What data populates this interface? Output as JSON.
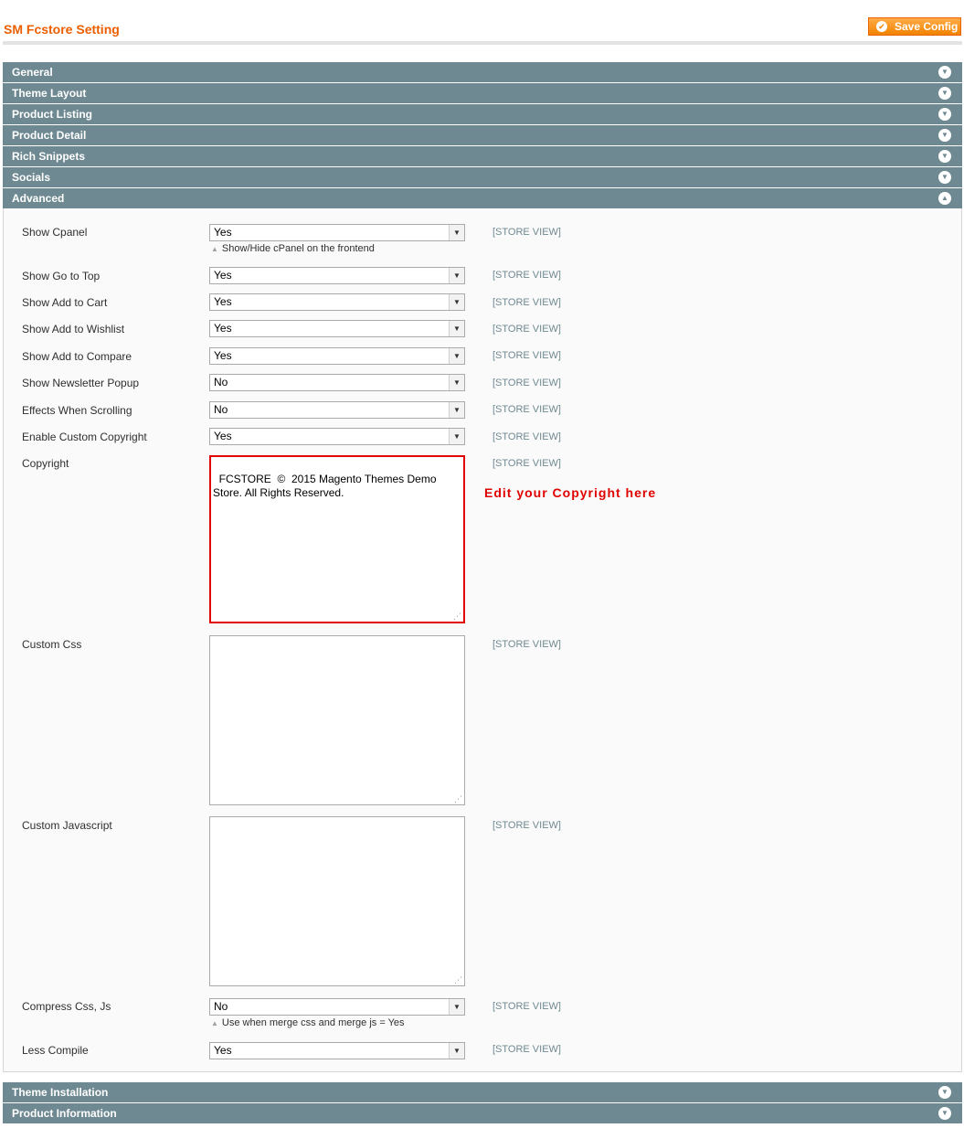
{
  "header": {
    "title": "SM Fcstore Setting",
    "save_label": "Save Config"
  },
  "sections": [
    {
      "label": "General",
      "icon": "chevron-down-icon"
    },
    {
      "label": "Theme Layout",
      "icon": "chevron-down-icon"
    },
    {
      "label": "Product Listing",
      "icon": "chevron-down-icon"
    },
    {
      "label": "Product Detail",
      "icon": "chevron-down-icon"
    },
    {
      "label": "Rich Snippets",
      "icon": "chevron-down-icon"
    },
    {
      "label": "Socials",
      "icon": "chevron-down-icon"
    },
    {
      "label": "Advanced",
      "icon": "chevron-up-icon"
    }
  ],
  "bottom_sections": [
    {
      "label": "Theme Installation",
      "icon": "chevron-down-icon"
    },
    {
      "label": "Product Information",
      "icon": "chevron-down-icon"
    }
  ],
  "scope_label": "[STORE VIEW]",
  "fields": {
    "show_cpanel": {
      "label": "Show Cpanel",
      "value": "Yes",
      "note": "Show/Hide cPanel on the frontend"
    },
    "show_go_to_top": {
      "label": "Show Go to Top",
      "value": "Yes"
    },
    "show_add_to_cart": {
      "label": "Show Add to Cart",
      "value": "Yes"
    },
    "show_add_to_wishlist": {
      "label": "Show Add to Wishlist",
      "value": "Yes"
    },
    "show_add_to_compare": {
      "label": "Show Add to Compare",
      "value": "Yes"
    },
    "show_newsletter_popup": {
      "label": "Show Newsletter Popup",
      "value": "No"
    },
    "effects_when_scrolling": {
      "label": "Effects When Scrolling",
      "value": "No"
    },
    "enable_custom_copyright": {
      "label": "Enable Custom Copyright",
      "value": "Yes"
    },
    "copyright": {
      "label": "Copyright",
      "value": "FCSTORE  ©  2015 Magento Themes Demo Store. All Rights Reserved."
    },
    "custom_css": {
      "label": "Custom Css",
      "value": ""
    },
    "custom_javascript": {
      "label": "Custom Javascript",
      "value": ""
    },
    "compress_css_js": {
      "label": "Compress Css, Js",
      "value": "No",
      "note": "Use when merge css and merge js = Yes"
    },
    "less_compile": {
      "label": "Less Compile",
      "value": "Yes"
    }
  },
  "annotation": "Edit your Copyright here",
  "colors": {
    "section_bar": "#6f8992",
    "title": "#eb5e00",
    "save_button": "#f18200",
    "highlight": "#e00000"
  }
}
